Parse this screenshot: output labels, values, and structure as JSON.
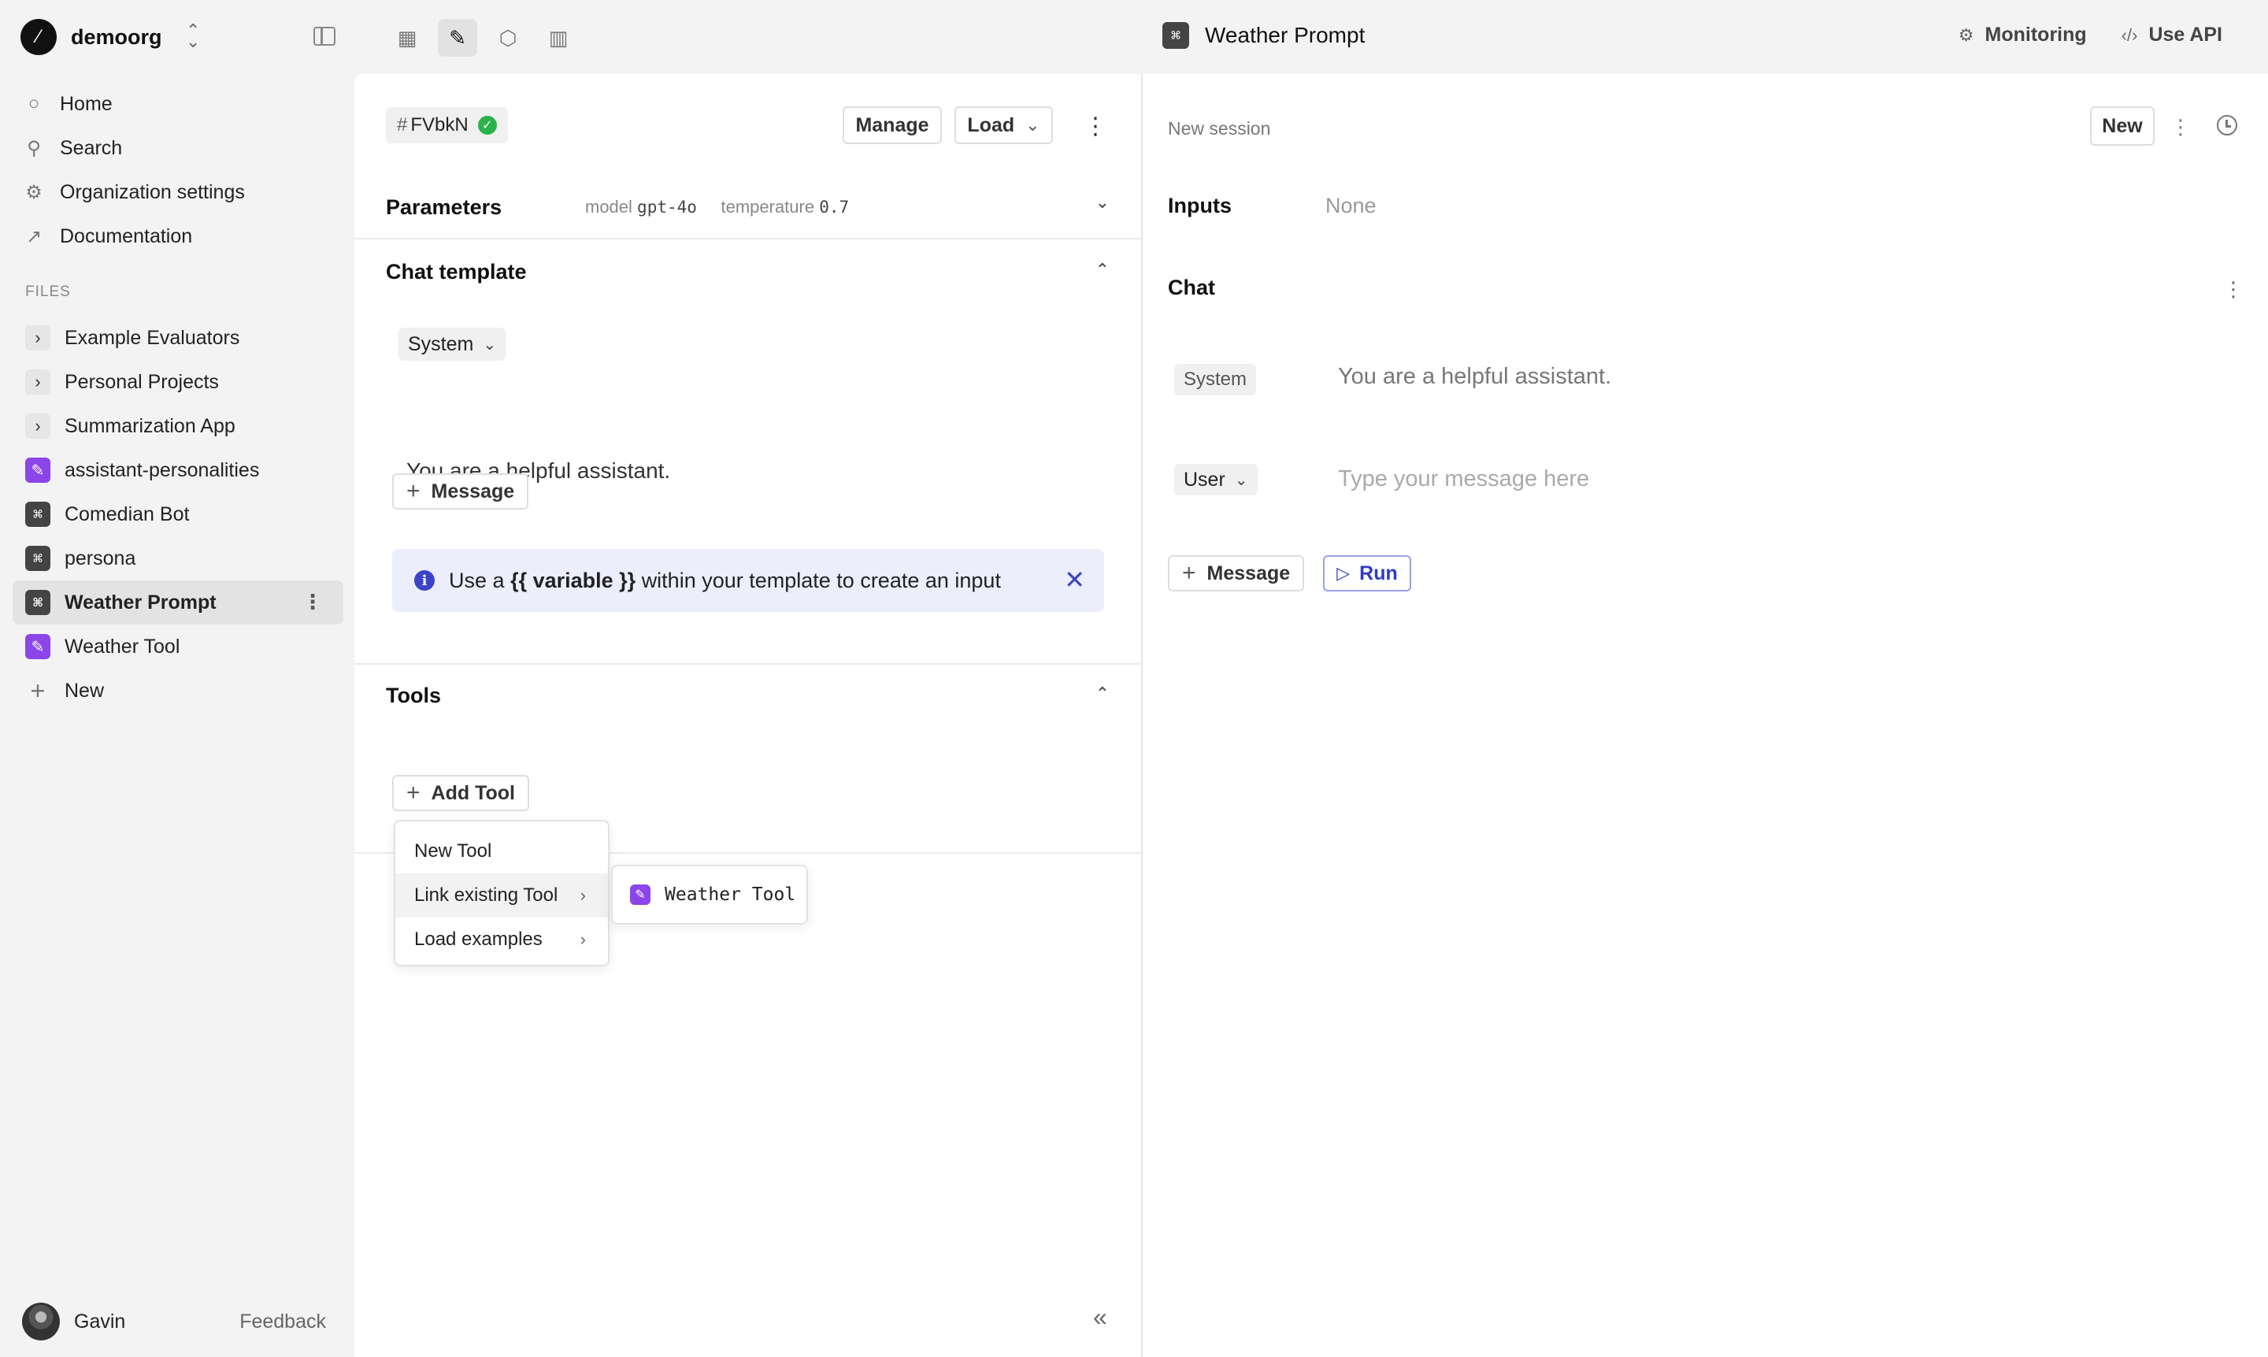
{
  "sidebar": {
    "org_name": "demoorg",
    "nav": [
      {
        "label": "Home",
        "icon": "circle-icon"
      },
      {
        "label": "Search",
        "icon": "search-icon"
      },
      {
        "label": "Organization settings",
        "icon": "gear-icon"
      },
      {
        "label": "Documentation",
        "icon": "arrow-up-right-icon"
      }
    ],
    "files_label": "FILES",
    "files": [
      {
        "label": "Example Evaluators",
        "type": "folder"
      },
      {
        "label": "Personal Projects",
        "type": "folder"
      },
      {
        "label": "Summarization App",
        "type": "folder"
      },
      {
        "label": "assistant-personalities",
        "type": "tool"
      },
      {
        "label": "Comedian Bot",
        "type": "prompt"
      },
      {
        "label": "persona",
        "type": "prompt"
      },
      {
        "label": "Weather Prompt",
        "type": "prompt",
        "active": true
      },
      {
        "label": "Weather Tool",
        "type": "tool"
      },
      {
        "label": "New",
        "type": "new"
      }
    ],
    "user_name": "Gavin",
    "feedback": "Feedback"
  },
  "topbar": {
    "title": "Weather Prompt",
    "monitoring": "Monitoring",
    "use_api": "Use API"
  },
  "editor": {
    "version_id": "FVbkN",
    "manage": "Manage",
    "load": "Load",
    "parameters": {
      "heading": "Parameters",
      "model_label": "model",
      "model_value": "gpt-4o",
      "temperature_label": "temperature",
      "temperature_value": "0.7"
    },
    "chat_template": {
      "heading": "Chat template",
      "role": "System",
      "system_text": "You are a helpful assistant.",
      "add_message": "Message"
    },
    "banner": {
      "pre": "Use a",
      "variable": "{{ variable }}",
      "post": "within your template to create an input"
    },
    "tools": {
      "heading": "Tools",
      "add_tool": "Add Tool",
      "menu": [
        "New Tool",
        "Link existing Tool",
        "Load examples"
      ],
      "submenu_item": "Weather Tool"
    }
  },
  "session": {
    "label": "New session",
    "new": "New",
    "inputs_heading": "Inputs",
    "inputs_value": "None",
    "chat_heading": "Chat",
    "system_role": "System",
    "system_text": "You are a helpful assistant.",
    "user_role": "User",
    "user_placeholder": "Type your message here",
    "add_message": "Message",
    "run": "Run"
  },
  "colors": {
    "accent": "#2f3ac4",
    "tool_icon": "#8b45e8",
    "success": "#2bb24c",
    "banner_bg": "#eceefb"
  }
}
